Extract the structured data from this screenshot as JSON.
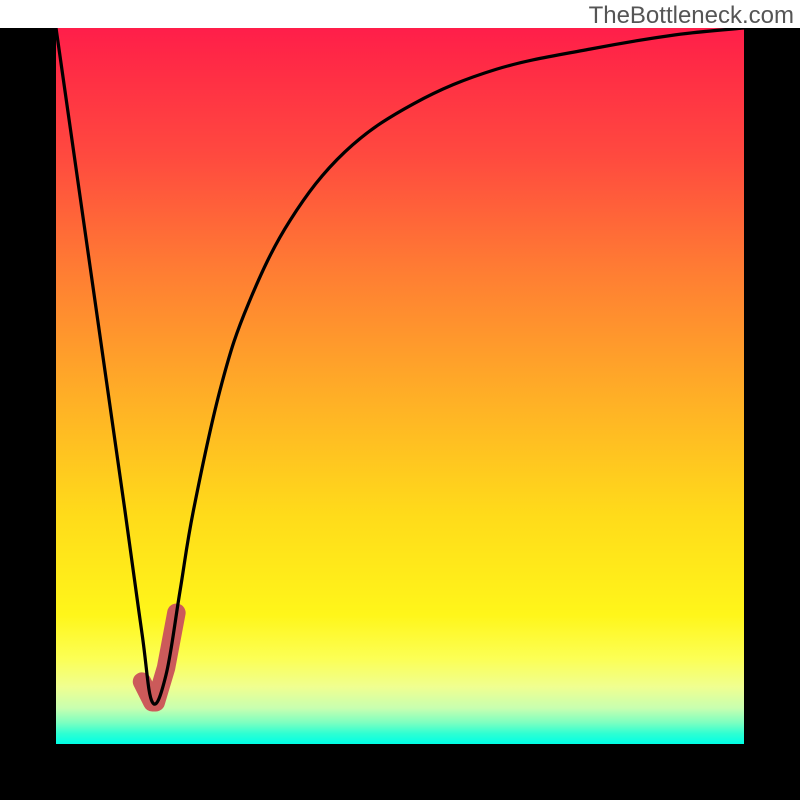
{
  "watermark": "TheBottleneck.com",
  "colors": {
    "frame": "#000000",
    "curve_primary": "#000000",
    "curve_marker": "#cc5a5a"
  },
  "chart_data": {
    "type": "line",
    "title": "",
    "xlabel": "",
    "ylabel": "",
    "xlim": [
      0,
      100
    ],
    "ylim": [
      0,
      100
    ],
    "series": [
      {
        "name": "bottleneck-curve",
        "x": [
          0,
          5,
          10,
          12.5,
          14,
          16,
          18,
          20,
          24,
          28,
          34,
          42,
          52,
          64,
          78,
          90,
          100
        ],
        "y": [
          100,
          65,
          30,
          12,
          2,
          6,
          18,
          30,
          48,
          60,
          72,
          82,
          89,
          94,
          97,
          99,
          100
        ]
      },
      {
        "name": "highlight-segment",
        "x": [
          12.5,
          14,
          14.5,
          16,
          17.5
        ],
        "y": [
          5,
          2,
          2,
          7,
          15
        ]
      }
    ],
    "gradient_stops": [
      {
        "pos": 0.0,
        "color": "#ff1e4a"
      },
      {
        "pos": 0.18,
        "color": "#ff4a3f"
      },
      {
        "pos": 0.34,
        "color": "#ff7d33"
      },
      {
        "pos": 0.52,
        "color": "#ffb026"
      },
      {
        "pos": 0.68,
        "color": "#ffdb1a"
      },
      {
        "pos": 0.82,
        "color": "#fff61a"
      },
      {
        "pos": 0.92,
        "color": "#f0ff90"
      },
      {
        "pos": 1.0,
        "color": "#00ffe6"
      }
    ]
  }
}
